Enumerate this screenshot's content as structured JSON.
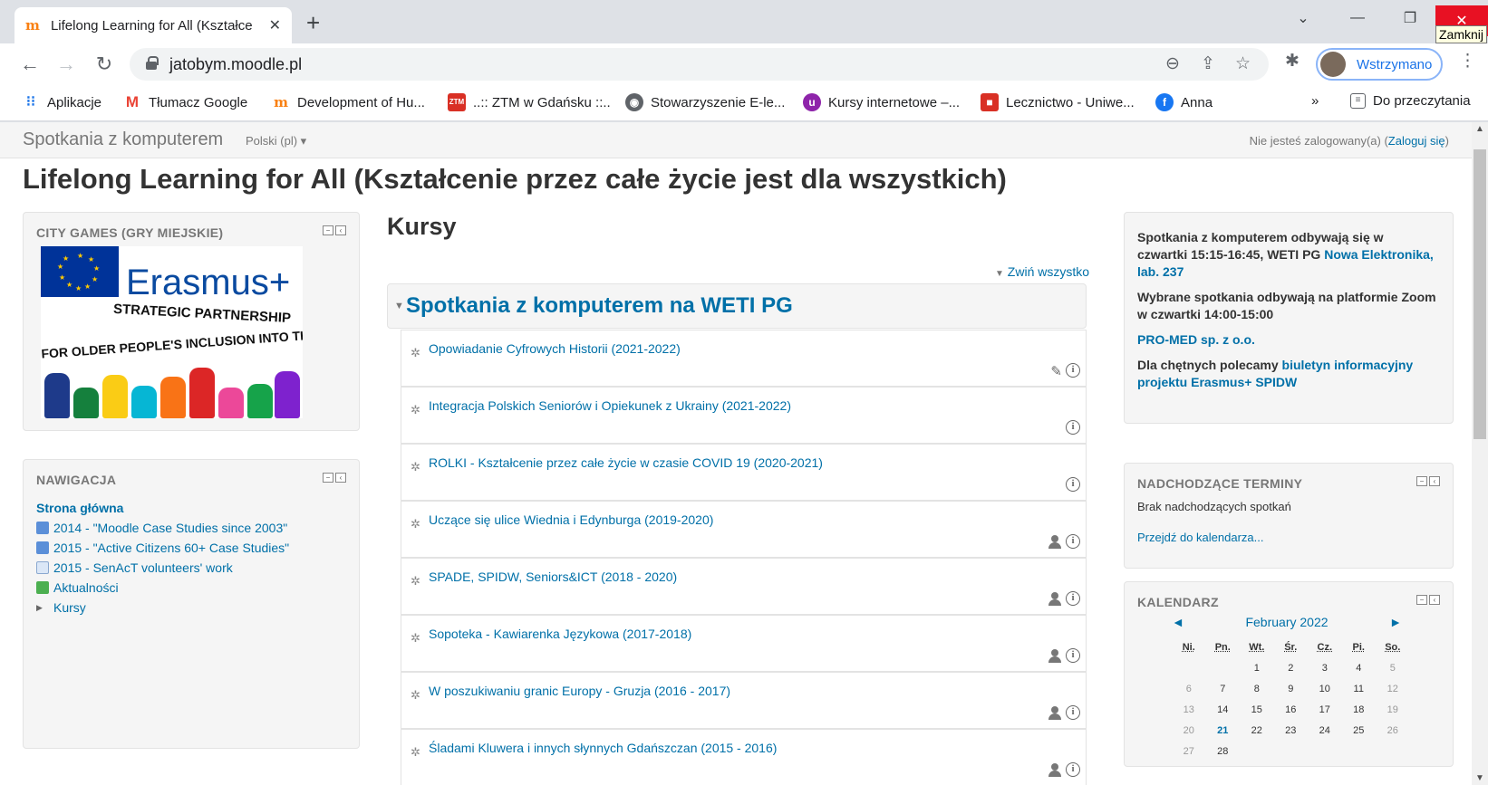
{
  "browser": {
    "tab_title": "Lifelong Learning for All (Kształce",
    "tab_close": "✕",
    "new_tab": "+",
    "minimize": "—",
    "restore": "❐",
    "close": "✕",
    "close_tooltip": "Zamknij",
    "url": "jatobym.moodle.pl",
    "profile_label": "Wstrzymano",
    "bookmarks": [
      {
        "label": "Aplikacje",
        "icon": "apps-grid-icon",
        "color": "#1a73e8"
      },
      {
        "label": "Tłumacz Google",
        "icon": "gmail-icon",
        "color": "#ea4335"
      },
      {
        "label": "Development of Hu...",
        "icon": "moodle-icon",
        "color": "#f98012"
      },
      {
        "label": "..:: ZTM w Gdańsku ::..",
        "icon": "ztm-icon",
        "color": "#d93025"
      },
      {
        "label": "Stowarzyszenie E-le...",
        "icon": "globe-icon",
        "color": "#5f6368"
      },
      {
        "label": "Kursy internetowe –...",
        "icon": "kursy-icon",
        "color": "#8e24aa"
      },
      {
        "label": "Lecznictwo - Uniwe...",
        "icon": "lock-icon",
        "color": "#d93025"
      },
      {
        "label": "Anna",
        "icon": "facebook-icon",
        "color": "#1877f2"
      }
    ],
    "overflow": "»",
    "reading_list": "Do przeczytania"
  },
  "navbar": {
    "brand": "Spotkania z komputerem",
    "language": "Polski (pl) ▾",
    "login_prefix": "Nie jesteś zalogowany(a) (",
    "login_link": "Zaloguj się",
    "login_suffix": ")"
  },
  "page_title": "Lifelong Learning for All (Kształcenie przez całe życie jest dla wszystkich)",
  "city_games": {
    "title": "CITY GAMES (GRY MIEJSKIE)",
    "logo_wordmark": "Erasmus+",
    "logo_line1": "STRATEGIC PARTNERSHIP",
    "logo_line2": "FOR OLDER PEOPLE'S INCLUSION INTO THE DIGITAL WORLD"
  },
  "navigation": {
    "title": "NAWIGACJA",
    "home": "Strona główna",
    "items": [
      {
        "label": "2014 - \"Moodle Case Studies since 2003\"",
        "icon": "database-icon"
      },
      {
        "label": "2015 - \"Active Citizens 60+ Case Studies\"",
        "icon": "database-icon"
      },
      {
        "label": "2015 - SenAcT volunteers' work",
        "icon": "page-icon"
      },
      {
        "label": "Aktualności",
        "icon": "forum-icon"
      },
      {
        "label": "Kursy",
        "icon": "expand-icon"
      }
    ]
  },
  "courses": {
    "heading": "Kursy",
    "collapse_all": "Zwiń wszystko",
    "category": "Spotkania z komputerem na WETI PG",
    "items": [
      {
        "name": "Opowiadanie Cyfrowych Historii (2021-2022)",
        "icons": [
          "edit",
          "info"
        ]
      },
      {
        "name": "Integracja Polskich Seniorów i Opiekunek z Ukrainy (2021-2022)",
        "icons": [
          "info"
        ]
      },
      {
        "name": "ROLKI - Kształcenie przez całe życie w czasie COVID 19 (2020-2021)",
        "icons": [
          "info"
        ]
      },
      {
        "name": "Uczące się ulice Wiednia i Edynburga (2019-2020)",
        "icons": [
          "person",
          "info"
        ]
      },
      {
        "name": "SPADE, SPIDW, Seniors&ICT (2018 - 2020)",
        "icons": [
          "person",
          "info"
        ]
      },
      {
        "name": "Sopoteka - Kawiarenka Językowa (2017-2018)",
        "icons": [
          "person",
          "info"
        ]
      },
      {
        "name": "W poszukiwaniu granic Europy - Gruzja (2016 - 2017)",
        "icons": [
          "person",
          "info"
        ]
      },
      {
        "name": "Śladami Kluwera i innych słynnych Gdańszczan (2015 - 2016)",
        "icons": [
          "person",
          "info"
        ]
      }
    ]
  },
  "info_block": {
    "p1_text": "Spotkania z komputerem odbywają się w czwartki 15:15-16:45, WETI PG ",
    "p1_link": "Nowa Elektronika, lab. 237",
    "p2_text": "Wybrane spotkania odbywają na platformie Zoom w czwartki  14:00-15:00",
    "p3_link": "PRO-MED sp. z o.o.",
    "p4_text": "Dla chętnych polecamy ",
    "p4_link": "biuletyn informacyjny projektu Erasmus+ SPIDW"
  },
  "upcoming": {
    "title": "NADCHODZĄCE TERMINY",
    "empty": "Brak nadchodzących spotkań",
    "link": "Przejdź do kalendarza..."
  },
  "calendar": {
    "title": "KALENDARZ",
    "month": "February 2022",
    "prev": "◄",
    "next": "►",
    "days": [
      "Ni.",
      "Pn.",
      "Wt.",
      "Śr.",
      "Cz.",
      "Pi.",
      "So."
    ],
    "weeks": [
      [
        "",
        "",
        "1",
        "2",
        "3",
        "4",
        "5"
      ],
      [
        "6",
        "7",
        "8",
        "9",
        "10",
        "11",
        "12"
      ],
      [
        "13",
        "14",
        "15",
        "16",
        "17",
        "18",
        "19"
      ],
      [
        "20",
        "21",
        "22",
        "23",
        "24",
        "25",
        "26"
      ],
      [
        "27",
        "28",
        "",
        "",
        "",
        "",
        ""
      ]
    ],
    "today": "21"
  }
}
